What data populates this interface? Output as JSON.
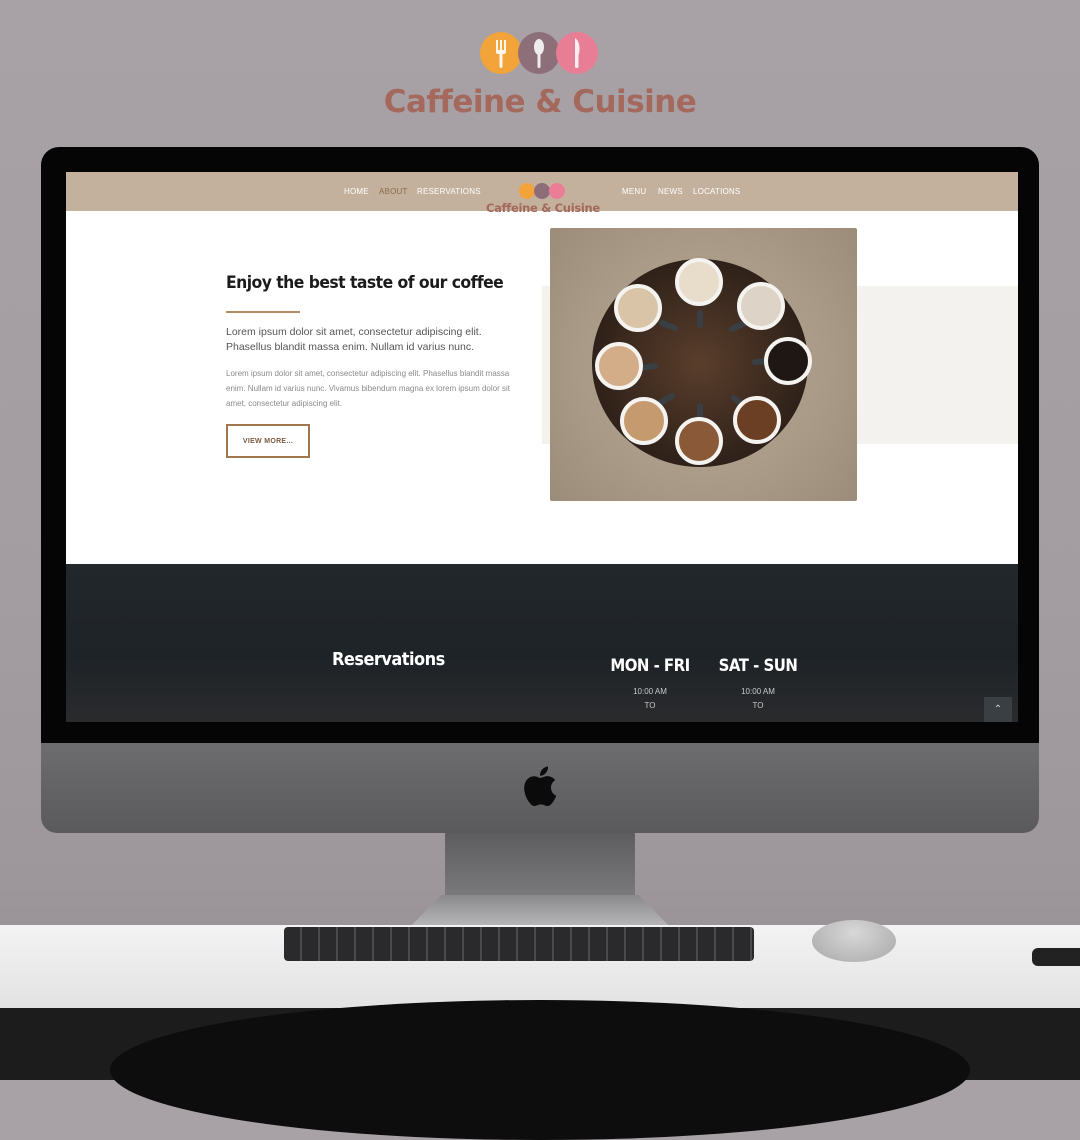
{
  "brand": {
    "name": "Caffeine & Cuisine",
    "colors": {
      "orange": "#f2a33a",
      "plum": "#8c6d78",
      "pink": "#ec7d96",
      "wordmark": "#a4685c"
    }
  },
  "site": {
    "nav": {
      "left": [
        "HOME",
        "ABOUT",
        "RESERVATIONS"
      ],
      "right": [
        "MENU",
        "NEWS",
        "LOCATIONS"
      ],
      "active": "ABOUT",
      "logo_text": "Caffeine & Cuisine",
      "bar_color": "#c3b19d"
    },
    "hero": {
      "title": "Enjoy the best taste of our coffee",
      "lead": "Lorem ipsum dolor sit amet, consectetur adipiscing elit. Phasellus blandit massa enim. Nullam id varius nunc.",
      "body": "Lorem ipsum dolor sit amet, consectetur adipiscing elit. Phasellus blandit massa enim. Nullam id varius nunc. Vivamus bibendum magna ex lorem ipsum dolor sit amet, consectetur adipiscing elit.",
      "button": "VIEW MORE...",
      "accent_color": "#b48c64"
    },
    "reservations": {
      "title": "Reservations",
      "hours": [
        {
          "days": "MON - FRI",
          "open": "10:00 AM",
          "to": "TO"
        },
        {
          "days": "SAT - SUN",
          "open": "10:00 AM",
          "to": "TO"
        }
      ],
      "to_top_icon": "chevron-up-icon"
    }
  },
  "device": {
    "logo_icon": "apple-logo-icon"
  }
}
